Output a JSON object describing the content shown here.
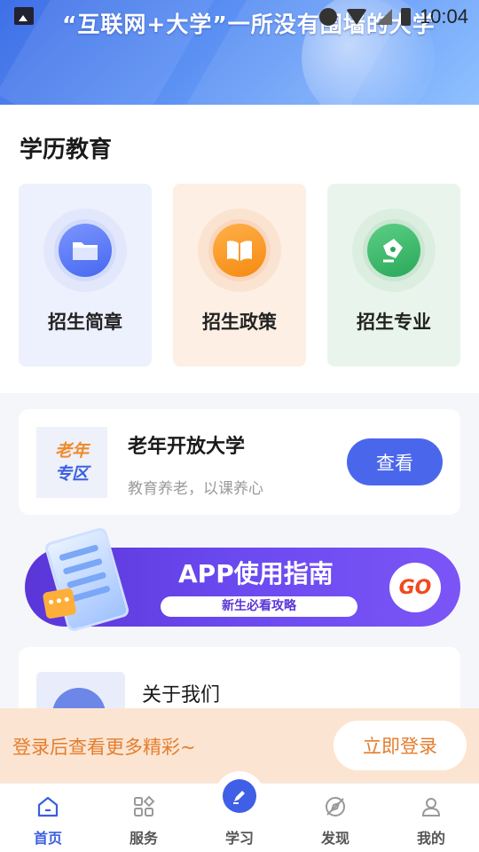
{
  "banner": {
    "title": "“互联网+大学”一所没有围墙的大学"
  },
  "status_bar": {
    "time": "10:04"
  },
  "education": {
    "title": "学历教育",
    "cards": [
      {
        "label": "招生简章",
        "icon": "folder-icon"
      },
      {
        "label": "招生政策",
        "icon": "book-icon"
      },
      {
        "label": "招生专业",
        "icon": "pen-nib-icon"
      }
    ]
  },
  "senior": {
    "logo_line1": "老年",
    "logo_line2": "专区",
    "title": "老年开放大学",
    "subtitle": "教育养老，以课养心",
    "button": "查看"
  },
  "guide": {
    "title": "APP使用指南",
    "pill": "新生必看攻略",
    "go": "GO"
  },
  "about": {
    "title": "关于我们"
  },
  "login": {
    "prompt": "登录后查看更多精彩~",
    "button": "立即登录"
  },
  "tabbar": {
    "items": [
      {
        "label": "首页",
        "icon": "home-icon",
        "active": true
      },
      {
        "label": "服务",
        "icon": "grid-icon",
        "active": false
      },
      {
        "label": "学习",
        "icon": "pen-icon",
        "active": false
      },
      {
        "label": "发现",
        "icon": "compass-icon",
        "active": false
      },
      {
        "label": "我的",
        "icon": "user-icon",
        "active": false
      }
    ]
  },
  "colors": {
    "accent": "#4a67ec",
    "login_text": "#e47d2e",
    "guide_bg": "#6b4af0"
  }
}
